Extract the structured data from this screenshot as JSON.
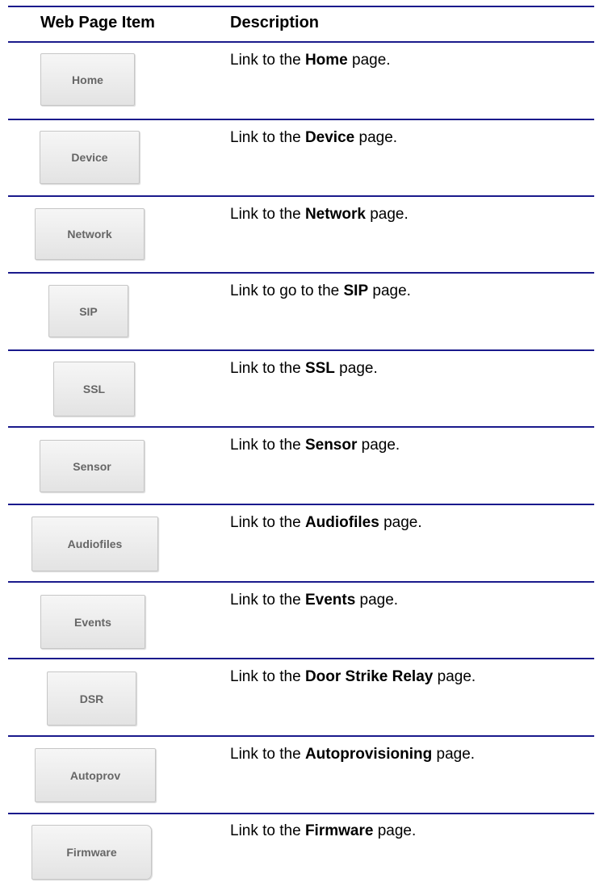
{
  "table": {
    "headers": {
      "item": "Web Page Item",
      "description": "Description"
    },
    "rows": [
      {
        "button": "Home",
        "prefix": "Link to the ",
        "bold": "Home",
        "suffix": " page."
      },
      {
        "button": "Device",
        "prefix": "Link to the ",
        "bold": "Device",
        "suffix": " page."
      },
      {
        "button": "Network",
        "prefix": "Link to the ",
        "bold": "Network",
        "suffix": " page."
      },
      {
        "button": "SIP",
        "prefix": "Link to go to the ",
        "bold": "SIP",
        "suffix": " page."
      },
      {
        "button": "SSL",
        "prefix": "Link to the ",
        "bold": "SSL",
        "suffix": " page."
      },
      {
        "button": "Sensor",
        "prefix": "Link to the ",
        "bold": "Sensor",
        "suffix": " page."
      },
      {
        "button": "Audiofiles",
        "prefix": "Link to the ",
        "bold": "Audiofiles",
        "suffix": " page."
      },
      {
        "button": "Events",
        "prefix": "Link to the ",
        "bold": "Events",
        "suffix": " page."
      },
      {
        "button": "DSR",
        "prefix": "Link to the ",
        "bold": "Door Strike Relay",
        "suffix": " page."
      },
      {
        "button": "Autoprov",
        "prefix": "Link to the ",
        "bold": "Autoprovisioning",
        "suffix": " page."
      },
      {
        "button": "Firmware",
        "prefix": "Link to the ",
        "bold": "Firmware",
        "suffix": " page."
      }
    ]
  }
}
